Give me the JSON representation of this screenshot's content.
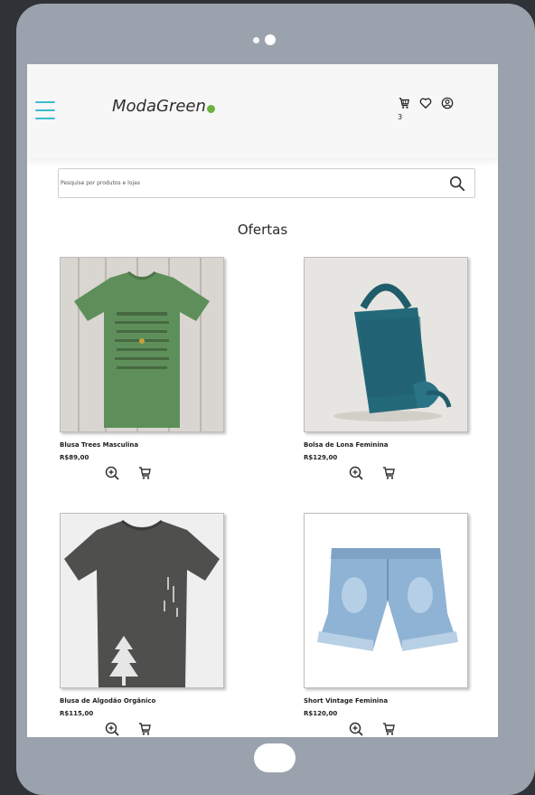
{
  "header": {
    "logo_text": "ModaGreen",
    "cart_count": "3"
  },
  "search": {
    "placeholder": "Pesquise por produtos e lojas",
    "value": ""
  },
  "section": {
    "title": "Ofertas"
  },
  "products": [
    {
      "name": "Blusa Trees Masculina",
      "price": "R$89,00",
      "image": "green-tshirt"
    },
    {
      "name": "Bolsa de Lona Feminina",
      "price": "R$129,00",
      "image": "teal-tote-bag"
    },
    {
      "name": "Blusa de Algodão Orgânico",
      "price": "R$115,00",
      "image": "gray-tshirt"
    },
    {
      "name": "Short Vintage Feminina",
      "price": "R$120,00",
      "image": "denim-shorts"
    }
  ],
  "icons": {
    "menu": "hamburger-menu-icon",
    "cart": "cart-icon",
    "wishlist": "heart-icon",
    "account": "user-icon",
    "search": "search-icon",
    "zoom": "zoom-in-icon",
    "add_to_cart": "add-to-cart-icon"
  },
  "colors": {
    "accent_menu": "#3bbcd0",
    "brand_dot": "#6db33f",
    "device_frame": "#9aa2ad",
    "background": "#2f3338"
  }
}
